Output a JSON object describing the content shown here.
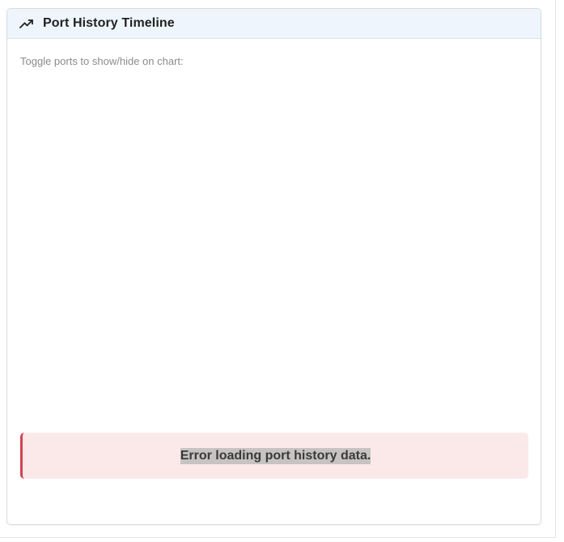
{
  "card": {
    "title": "Port History Timeline",
    "icon": "trending-up-icon"
  },
  "body": {
    "toggle_label": "Toggle ports to show/hide on chart:"
  },
  "alert": {
    "message": "Error loading port history data.",
    "accent_color": "#d1434f",
    "background_color": "#fbe9ea"
  },
  "colors": {
    "header_background": "#eef5fd"
  }
}
